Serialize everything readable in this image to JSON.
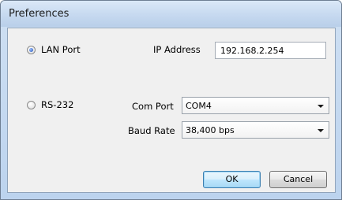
{
  "window": {
    "title": "Preferences"
  },
  "connection": {
    "lan": {
      "label": "LAN Port",
      "checked": true
    },
    "rs232": {
      "label": "RS-232",
      "checked": false
    }
  },
  "ip": {
    "label": "IP Address",
    "value": "192.168.2.254"
  },
  "com_port": {
    "label": "Com Port",
    "value": "COM4"
  },
  "baud_rate": {
    "label": "Baud Rate",
    "value": "38,400 bps"
  },
  "buttons": {
    "ok": "OK",
    "cancel": "Cancel"
  }
}
